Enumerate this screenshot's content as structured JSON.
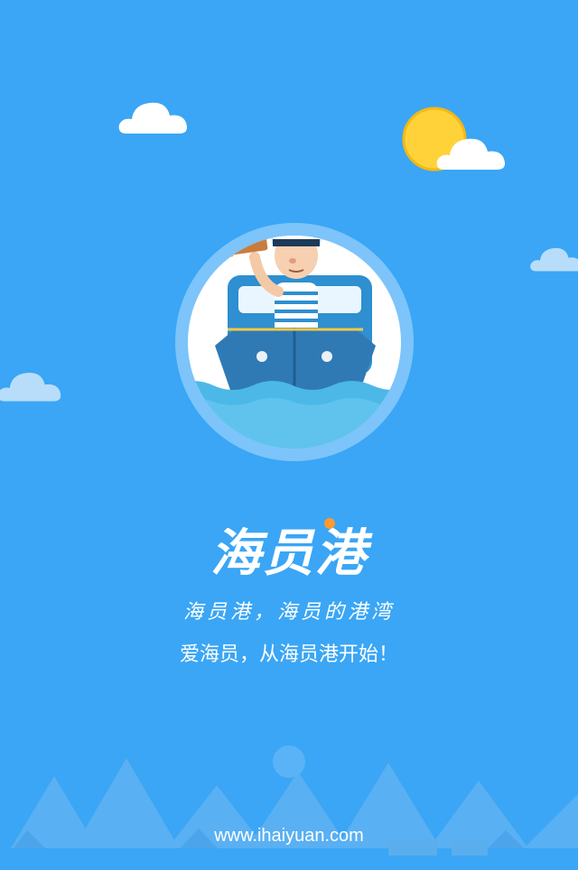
{
  "brand": {
    "logo_text": "海员港",
    "slogan_primary": "海员港，海员的港湾",
    "slogan_secondary": "爱海员，从海员港开始！",
    "website": "www.ihaiyuan.com"
  },
  "colors": {
    "background": "#3aa6f5",
    "sun": "#ffd23a",
    "accent_dot": "#ff9a2e",
    "cloud": "#ffffff"
  },
  "icons": {
    "hero": "sailor-boat-illustration",
    "sun": "sun-icon",
    "cloud": "cloud-icon"
  }
}
